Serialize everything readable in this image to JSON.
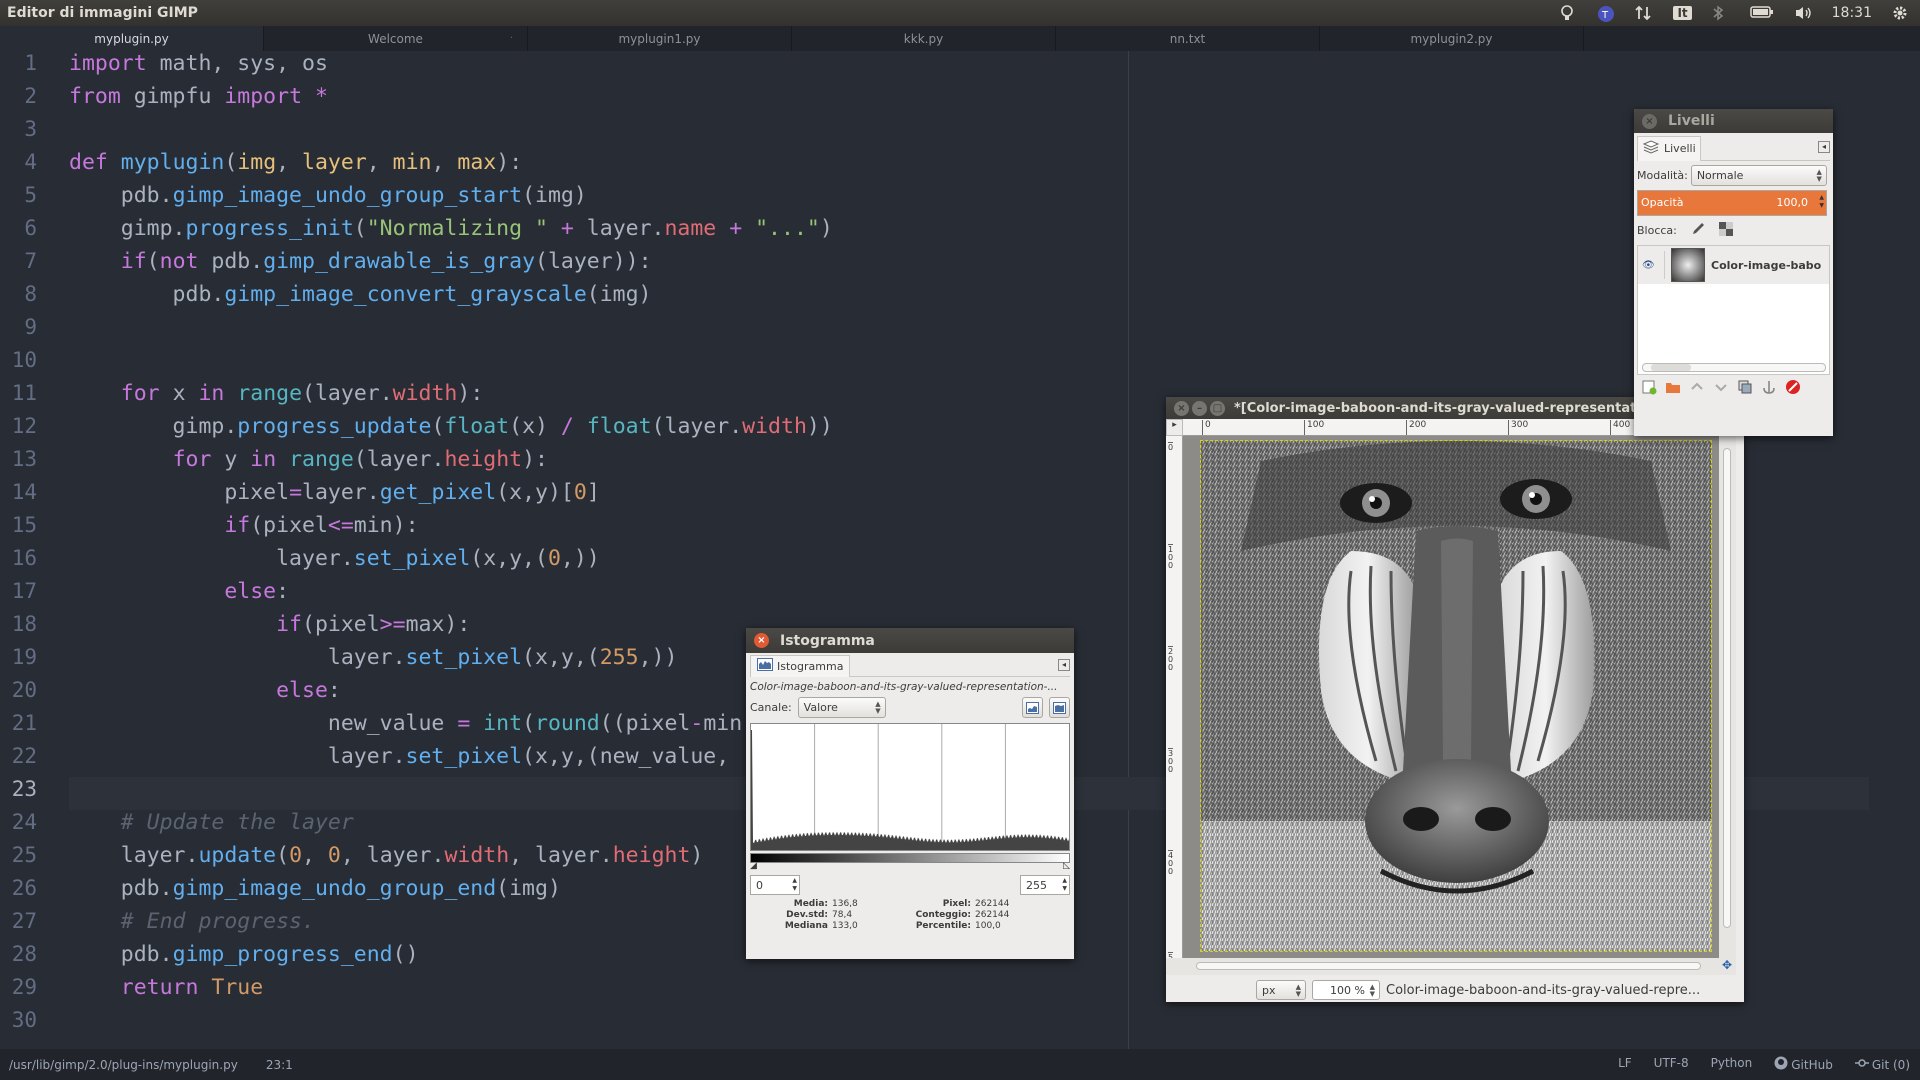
{
  "topbar": {
    "app_title": "Editor di immagini GIMP",
    "keyboard_layout": "It",
    "clock": "18:31"
  },
  "tabs": [
    {
      "label": "myplugin.py",
      "active": true
    },
    {
      "label": "Welcome",
      "active": false
    },
    {
      "label": "myplugin1.py",
      "active": false
    },
    {
      "label": "kkk.py",
      "active": false
    },
    {
      "label": "nn.txt",
      "active": false
    },
    {
      "label": "myplugin2.py",
      "active": false
    }
  ],
  "editor": {
    "line_numbers": [
      "1",
      "2",
      "3",
      "4",
      "5",
      "6",
      "7",
      "8",
      "9",
      "10",
      "11",
      "12",
      "13",
      "14",
      "15",
      "16",
      "17",
      "18",
      "19",
      "20",
      "21",
      "22",
      "23",
      "24",
      "25",
      "26",
      "27",
      "28",
      "29",
      "30"
    ],
    "current_line": 23
  },
  "statusbar": {
    "file_path": "/usr/lib/gimp/2.0/plug-ins/myplugin.py",
    "cursor_position": "23:1",
    "line_ending": "LF",
    "encoding": "UTF-8",
    "grammar": "Python",
    "github": "GitHub",
    "git": "Git (0)"
  },
  "layers_dialog": {
    "title": "Livelli",
    "tab_label": "Livelli",
    "mode_label": "Modalità:",
    "mode_value": "Normale",
    "opacity_label": "Opacità",
    "opacity_value": "100,0",
    "opacity_percent": 100,
    "lock_label": "Blocca:",
    "layer_name": "Color-image-babo"
  },
  "histogram_dialog": {
    "title": "Istogramma",
    "tab_label": "Istogramma",
    "image_name": "Color-image-baboon-and-its-gray-valued-representation-...",
    "channel_label": "Canale:",
    "channel_value": "Valore",
    "range_min": "0",
    "range_max": "255",
    "stats": {
      "media_label": "Media:",
      "media_value": "136,8",
      "devstd_label": "Dev.std:",
      "devstd_value": "78,4",
      "mediana_label": "Mediana",
      "mediana_value": "133,0",
      "pixel_label": "Pixel:",
      "pixel_value": "262144",
      "conteggio_label": "Conteggio:",
      "conteggio_value": "262144",
      "percentile_label": "Percentile:",
      "percentile_value": "100,0"
    }
  },
  "image_window": {
    "title": "*[Color-image-baboon-and-its-gray-valued-representat",
    "ruler_h": [
      "0",
      "100",
      "200",
      "300",
      "400"
    ],
    "ruler_v": [
      "0",
      "1\n0\n0",
      "2\n0\n0",
      "3\n0\n0",
      "4\n0\n0",
      "5"
    ],
    "unit": "px",
    "zoom": "100 %",
    "status_text": "Color-image-baboon-and-its-gray-valued-repre..."
  },
  "colors": {
    "editor_bg": "#282c34",
    "accent_orange": "#e8773c",
    "gimp_bg": "#edeceb"
  }
}
